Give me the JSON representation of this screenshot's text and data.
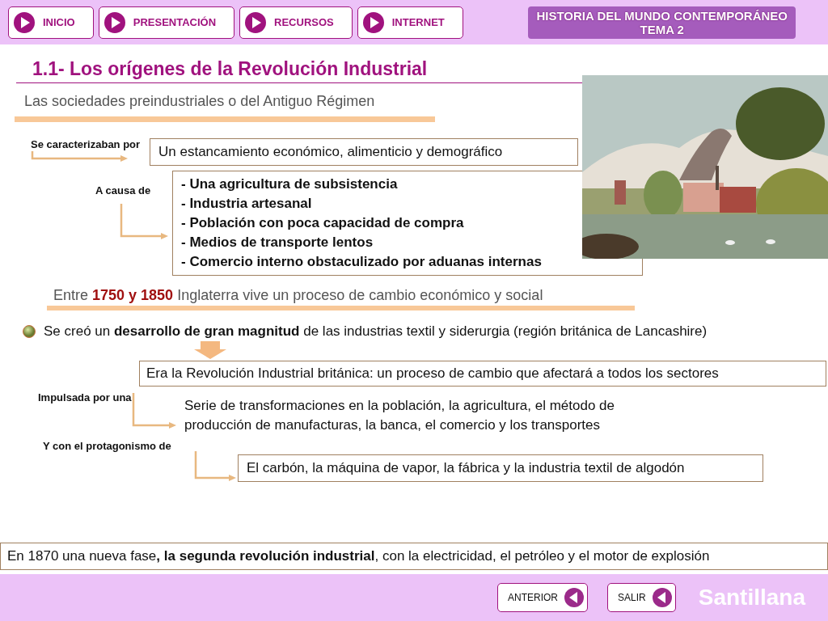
{
  "nav_buttons": [
    {
      "label": "INICIO"
    },
    {
      "label": "PRESENTACIÓN"
    },
    {
      "label": "RECURSOS"
    },
    {
      "label": "INTERNET"
    }
  ],
  "course_title": [
    "HISTORIA DEL MUNDO CONTEMPORÁNEO",
    "TEMA 2"
  ],
  "title": "1.1- Los orígenes de la Revolución Industrial",
  "subtitle": "Las sociedades preindustriales o del Antiguo Régimen",
  "characterized": {
    "label": "Se caracterizaban por",
    "text": "Un estancamiento económico, alimenticio y demográfico"
  },
  "causes": {
    "label": "A causa de",
    "items": [
      "- Una agricultura de subsistencia",
      "- Industria artesanal",
      "- Población con poca capacidad de compra",
      "- Medios de transporte lentos",
      "- Comercio interno obstaculizado por aduanas internas"
    ]
  },
  "period": "Entre **1750 y 1850** Inglaterra vive un proceso de cambio económico y social",
  "development": "Se creó un **desarrollo de gran magnitud** de las industrias textil y siderurgia (región británica de Lancashire)",
  "revolution": "Era la Revolución Industrial británica: un proceso de cambio que afectará a todos los sectores",
  "driven": {
    "label": "Impulsada por una",
    "text": "Serie de transformaciones en la población, la agricultura, el método de producción de manufacturas, la banca, el comercio y los transportes"
  },
  "protagonists": {
    "label": "Y con el protagonismo de",
    "text": "El carbón, la máquina de vapor, la fábrica y la industria textil de algodón"
  },
  "second_revolution": "En 1870 una nueva fase**, la segunda revolución industrial**, con la electricidad, el petróleo y el motor de explosión",
  "footer_buttons": [
    {
      "label": "ANTERIOR"
    },
    {
      "label": "SALIR"
    }
  ],
  "logo": "Santillana"
}
